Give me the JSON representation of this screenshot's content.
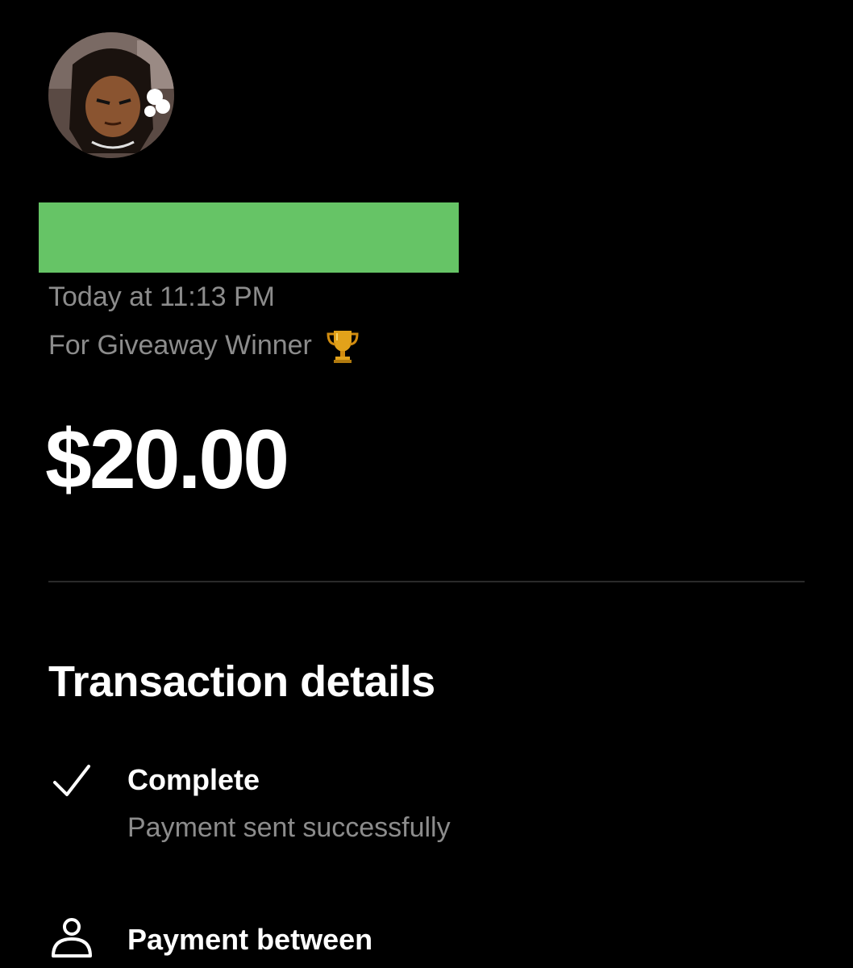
{
  "colors": {
    "background": "#000000",
    "primary_text": "#ffffff",
    "secondary_text": "#8c8c8c",
    "redaction": "#66c466",
    "divider": "#2a2a2a"
  },
  "header": {
    "timestamp": "Today at 11:13 PM",
    "note": "For Giveaway Winner",
    "note_icon": "trophy-icon"
  },
  "amount": "$20.00",
  "transaction_details": {
    "title": "Transaction details",
    "items": [
      {
        "icon": "checkmark-icon",
        "title": "Complete",
        "subtitle": "Payment sent successfully"
      },
      {
        "icon": "person-icon",
        "title": "Payment between"
      }
    ]
  }
}
